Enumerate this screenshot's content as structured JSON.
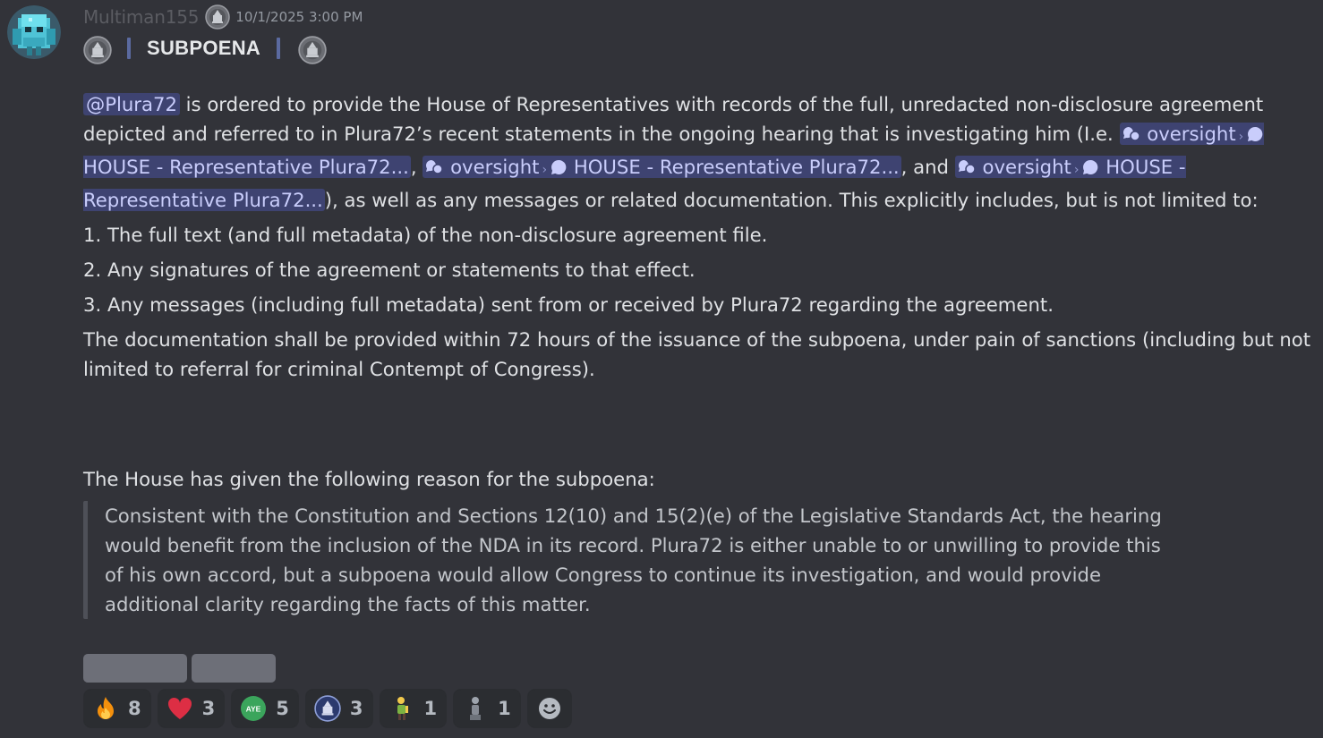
{
  "author": {
    "username": "Multiman155",
    "timestamp": "10/1/2025 3:00 PM",
    "avatar_icon": "minecraft-diamond-golem-avatar",
    "role_icon": "capitol-seal-icon"
  },
  "title": "SUBPOENA",
  "body": {
    "mention": "@Plura72",
    "p1_a": " is ordered to provide the House of Representatives with records of the full, unredacted non-disclosure agreement depicted and referred to in Plura72’s recent statements in the ongoing hearing that is investigating him (I.e. ",
    "links": [
      {
        "forum": "oversight",
        "thread": "HOUSE - Representative Plura72..."
      },
      {
        "forum": "oversight",
        "thread": "HOUSE - Representative Plura72..."
      },
      {
        "forum": "oversight",
        "thread": "HOUSE - Representative Plura72..."
      }
    ],
    "sep1": ", ",
    "sep2": ", and ",
    "p1_b": "), as well as any messages or related documentation. This explicitly includes, but is not limited to:",
    "list": [
      "1. The full text (and full metadata) of the non-disclosure agreement file.",
      "2. Any signatures of the agreement or statements to that effect.",
      "3. Any messages (including full metadata) sent from or received by Plura72 regarding the agreement."
    ],
    "closing": "The documentation shall be provided within 72 hours of the issuance of the subpoena, under pain of sanctions (including but not limited to referral for criminal Contempt of Congress)."
  },
  "reason_intro": "The House has given the following reason for the subpoena:",
  "reason_quote": "Consistent with the Constitution and Sections 12(10) and 15(2)(e) of the Legislative Standards Act, the hearing would benefit from the inclusion of the NDA in its record. Plura72 is either unable to or unwilling to provide this of his own accord, but a subpoena would allow Congress to continue its investigation, and would provide additional clarity regarding the facts of this matter.",
  "reactions": [
    {
      "emoji": "fire-emoji",
      "count": "8"
    },
    {
      "emoji": "red-heart-emoji",
      "count": "3"
    },
    {
      "emoji": "aye-vote-emoji",
      "label": "AYE",
      "count": "5"
    },
    {
      "emoji": "capitol-seal-emoji",
      "count": "3"
    },
    {
      "emoji": "person-figure-emoji",
      "count": "1"
    },
    {
      "emoji": "statue-figure-emoji",
      "count": "1"
    }
  ],
  "colors": {
    "background": "#323339",
    "mention_bg": "#3e4371",
    "mention_text": "#c9cdfb",
    "quote_bar": "#4e5058",
    "button": "#6d6f78"
  }
}
